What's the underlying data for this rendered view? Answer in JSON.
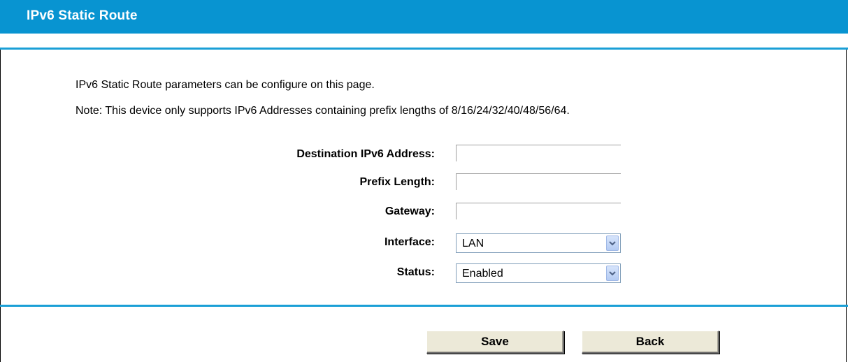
{
  "header": {
    "title": "IPv6 Static Route"
  },
  "description": {
    "line1": "IPv6 Static Route parameters can be configure on this page.",
    "line2": "Note: This device only supports IPv6 Addresses containing prefix lengths of 8/16/24/32/40/48/56/64."
  },
  "form": {
    "destination": {
      "label": "Destination IPv6 Address:",
      "value": ""
    },
    "prefix_length": {
      "label": "Prefix Length:",
      "value": ""
    },
    "gateway": {
      "label": "Gateway:",
      "value": ""
    },
    "interface": {
      "label": "Interface:",
      "selected": "LAN"
    },
    "status": {
      "label": "Status:",
      "selected": "Enabled"
    }
  },
  "buttons": {
    "save_label": "Save",
    "back_label": "Back"
  },
  "colors": {
    "accent": "#0894d1",
    "rule": "#1a9fd6",
    "button_face": "#ece9d8"
  }
}
